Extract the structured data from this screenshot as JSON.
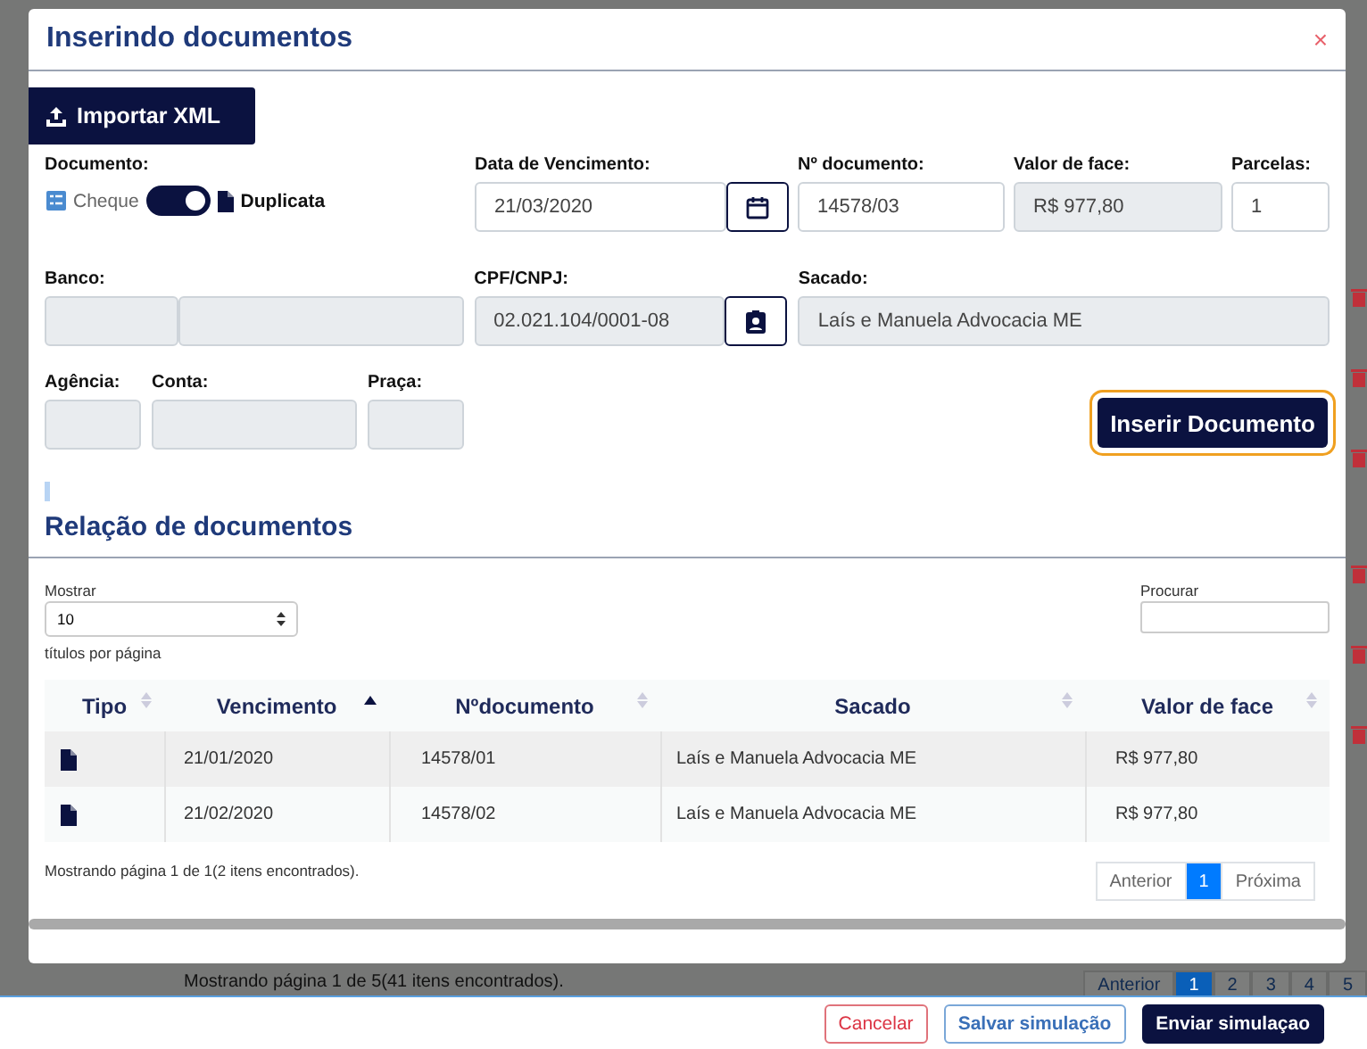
{
  "background": {
    "summary": "Mostrando página 1 de 5(41 itens encontrados).",
    "pagination": [
      {
        "label": "Anterior",
        "selected": false
      },
      {
        "label": "1",
        "selected": true
      },
      {
        "label": "2",
        "selected": false
      },
      {
        "label": "3",
        "selected": false
      },
      {
        "label": "4",
        "selected": false
      },
      {
        "label": "5",
        "selected": false
      }
    ]
  },
  "modal": {
    "title": "Inserindo documentos",
    "close": "×",
    "import_button": "Importar XML",
    "document": {
      "label": "Documento:",
      "left_option": "Cheque",
      "right_option": "Duplicata",
      "on": true
    },
    "row1": [
      {
        "label": "Data de Vencimento:",
        "value": "21/03/2020",
        "disabled": false,
        "kind": "date"
      },
      {
        "label": "Nº documento:",
        "value": "14578/03",
        "disabled": false
      },
      {
        "label": "Valor de face:",
        "value": "R$ 977,80",
        "disabled": true
      },
      {
        "label": "Parcelas:",
        "value": "1",
        "disabled": false
      }
    ],
    "row2": [
      {
        "label": "Banco:",
        "disabled": true,
        "kind": "split"
      },
      {
        "label": "CPF/CNPJ:",
        "value": "02.021.104/0001-08",
        "disabled": true,
        "kind": "person_id"
      },
      {
        "label": "Sacado:",
        "value": "Laís e Manuela Advocacia ME",
        "disabled": true
      }
    ],
    "row3": [
      {
        "label": "Agência:",
        "disabled": true
      },
      {
        "label": "Conta:",
        "disabled": true
      },
      {
        "label": "Praça:",
        "disabled": true
      }
    ],
    "insert_button": "Inserir Documento",
    "section_title": "Relação de documentos",
    "show_label": "Mostrar",
    "page_size": "10",
    "per_page": "títulos por página",
    "search_label": "Procurar",
    "table": {
      "columns": [
        {
          "label": "Tipo",
          "sorted": false
        },
        {
          "label": "Vencimento",
          "sorted": true
        },
        {
          "label": "Nºdocumento",
          "sorted": false
        },
        {
          "label": "Sacado",
          "sorted": false
        },
        {
          "label": "Valor de face",
          "sorted": false
        }
      ],
      "rows": [
        {
          "due": "21/01/2020",
          "number": "14578/01",
          "payer": "Laís e Manuela Advocacia ME",
          "value": "R$ 977,80"
        },
        {
          "due": "21/02/2020",
          "number": "14578/02",
          "payer": "Laís e Manuela Advocacia ME",
          "value": "R$ 977,80"
        }
      ]
    },
    "summary": "Mostrando página 1 de 1(2 itens encontrados).",
    "pagination": [
      {
        "label": "Anterior",
        "selected": false
      },
      {
        "label": "1",
        "selected": true
      },
      {
        "label": "Próxima",
        "selected": false
      }
    ]
  },
  "footer": [
    {
      "label": "Cancelar",
      "kind": "danger"
    },
    {
      "label": "Salvar simulação",
      "kind": "outline"
    },
    {
      "label": "Enviar simulaçao",
      "kind": "primary"
    }
  ]
}
